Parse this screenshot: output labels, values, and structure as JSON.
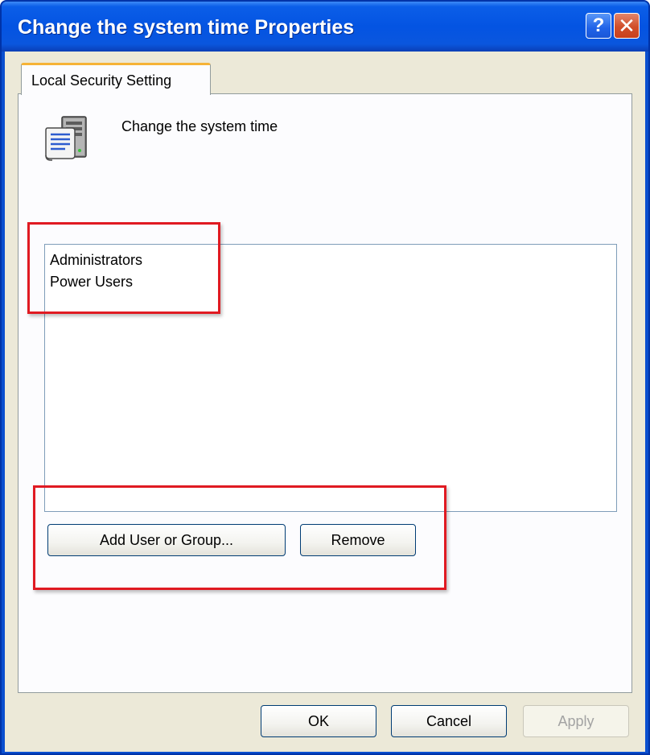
{
  "window": {
    "title": "Change the system time Properties",
    "help_button_label": "?",
    "close_button_label": "✕"
  },
  "tabs": [
    {
      "label": "Local Security Setting",
      "selected": true
    }
  ],
  "policy": {
    "icon": "policy-scroll-server-icon",
    "name": "Change the system time"
  },
  "members": {
    "items": [
      "Administrators",
      "Power Users"
    ]
  },
  "actions": {
    "add_label": "Add User or Group...",
    "remove_label": "Remove"
  },
  "footer": {
    "ok_label": "OK",
    "cancel_label": "Cancel",
    "apply_label": "Apply",
    "apply_disabled": true
  },
  "colors": {
    "titlebar": "#0454e2",
    "dialog_face": "#ece9d8",
    "tab_highlight": "#f6b336",
    "annotation_red": "#e01a22",
    "close_button": "#d14e2a"
  }
}
